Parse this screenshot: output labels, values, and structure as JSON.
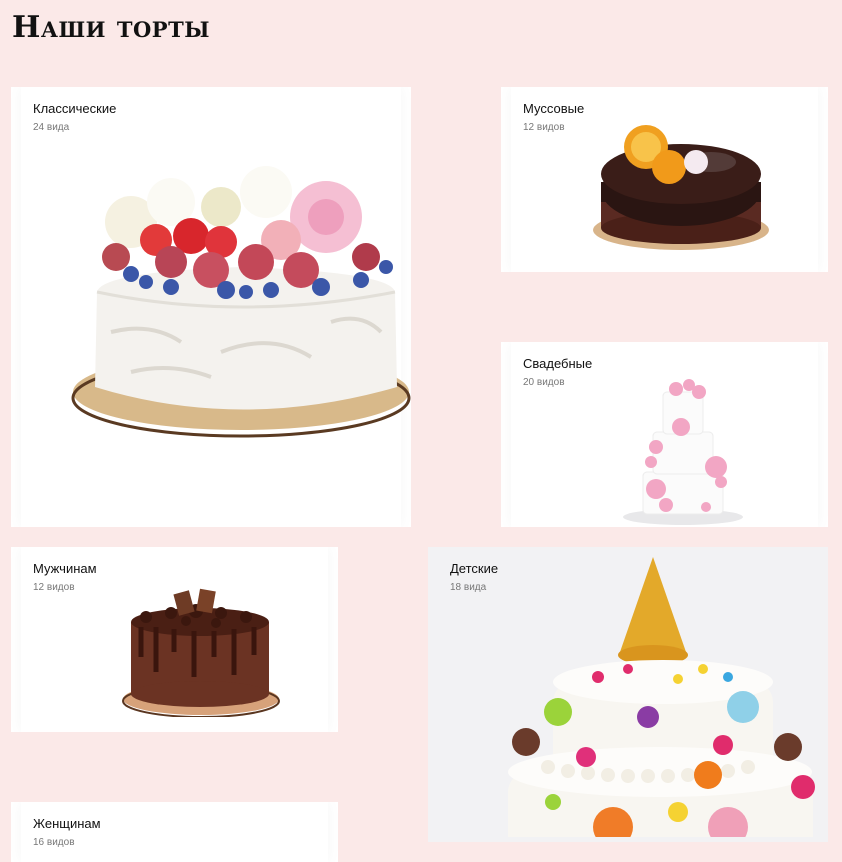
{
  "page": {
    "title": "Наши торты"
  },
  "categories": [
    {
      "name": "Классические",
      "count": "24 вида",
      "image": "white-cream-cake-with-berries-and-flowers"
    },
    {
      "name": "Муссовые",
      "count": "12 видов",
      "image": "chocolate-glazed-mousse-cake-with-orange"
    },
    {
      "name": "Свадебные",
      "count": "20 видов",
      "image": "three-tier-white-wedding-cake-with-pink-flowers"
    },
    {
      "name": "Мужчинам",
      "count": "12 видов",
      "image": "chocolate-drip-cake"
    },
    {
      "name": "Детские",
      "count": "18 вида",
      "image": "colorful-kids-cake-with-candies"
    },
    {
      "name": "Женщинам",
      "count": "16 видов",
      "image": "womens-cake"
    }
  ],
  "colors": {
    "background": "#fbe9e8",
    "card": "#ffffff",
    "title": "#111111",
    "muted": "#777777"
  }
}
